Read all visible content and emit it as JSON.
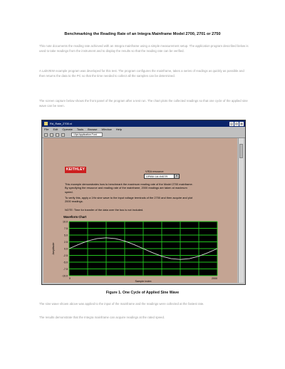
{
  "document": {
    "title": "Benchmarking the Reading Rate of an Integra Mainframe Model 2700, 2701 or 2750",
    "paragraphs": [
      "This note documents the reading rate achieved with an Integra mainframe using a simple measurement setup. The application program described below is used to take readings from the instrument and to display the results so that the reading rate can be verified.",
      "A LabVIEW example program was developed for this test. The program configures the mainframe, takes a series of readings as quickly as possible and then returns the data to the PC so that the time needed to collect all the samples can be determined.",
      "The screen capture below shows the front panel of the program after a test run. The chart plots the collected readings so that one cycle of the applied sine wave can be seen."
    ],
    "figure_caption": "Figure 1. One Cycle of Applied Sine Wave",
    "after_paragraphs": [
      "The sine wave shown above was applied to the input of the mainframe and the readings were collected at the fastest rate.",
      "The results demonstrate that the Integra mainframe can acquire readings at the rated speed."
    ]
  },
  "window": {
    "title": "Rd_Rate_2700.vi",
    "menus": [
      "File",
      "Edit",
      "Operate",
      "Tools",
      "Browse",
      "Window",
      "Help"
    ],
    "font_select": "13pt Application Font"
  },
  "panel": {
    "logo": "KEITHLEY",
    "resource_label": "VISA resource",
    "resource_value": "GPIB0::16::INSTR",
    "paragraphs": [
      "This example demonstrates how to benchmark the maximum reading rate of the Model 2700 mainframe. By specifying the resource and reading rate of the mainframe, 2000 readings are taken at maximum speed.",
      "To verify this, apply a 1Hz sine wave to the input voltage terminals of the 2700 and then acquire and plot 2000 readings.",
      "NOTE: Time for transfer of the data over the bus is not included."
    ],
    "chart": {
      "title": "Waveform Chart",
      "ylabel": "Amplitude",
      "xlabel": "Sample index",
      "yticks": [
        "10.0",
        "7.5",
        "5.0",
        "2.5",
        "0.0",
        "-2.5",
        "-5.0",
        "-7.5",
        "-10.0"
      ],
      "xticks": [
        "0",
        "2000"
      ]
    }
  },
  "chart_data": {
    "type": "line",
    "title": "Waveform Chart",
    "xlabel": "Sample index",
    "ylabel": "Amplitude",
    "xlim": [
      0,
      2000
    ],
    "ylim": [
      -10,
      10
    ],
    "grid": true,
    "series": [
      {
        "x": [
          0,
          125,
          250,
          375,
          500,
          625,
          750,
          875,
          1000,
          1125,
          1250,
          1375,
          1500,
          1625,
          1750,
          1875,
          2000
        ],
        "values": [
          0.0,
          1.5,
          2.8,
          3.7,
          4.0,
          3.7,
          2.8,
          1.5,
          0.0,
          -1.5,
          -2.8,
          -3.7,
          -4.0,
          -3.7,
          -2.8,
          -1.5,
          0.0
        ]
      }
    ],
    "colors": {
      "plot_bg": "#000000",
      "grid": "#22c41e",
      "line": "#d8d8d8"
    }
  }
}
